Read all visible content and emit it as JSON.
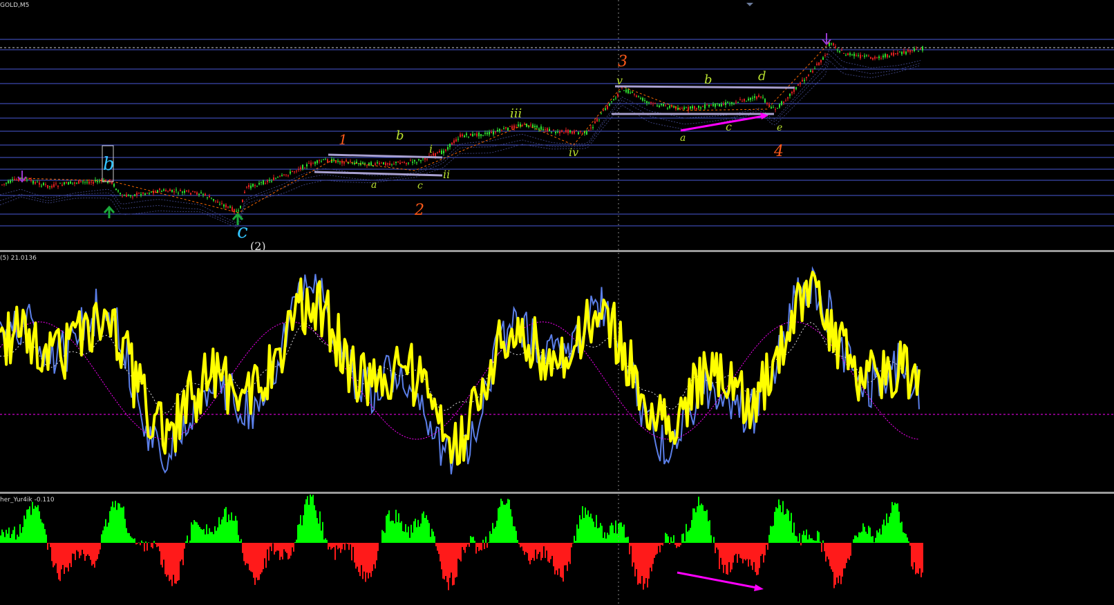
{
  "window": {
    "symbol_label": "GOLD,M5"
  },
  "panes": {
    "price": {
      "label": "GOLD,M5"
    },
    "oscillator": {
      "label": "(5) 21.0136"
    },
    "histogram": {
      "label": "her_Yur4ik -0.110"
    }
  },
  "wave_labels": {
    "wave_b_major": "b",
    "wave_c_major": "c",
    "wave_c_partial": "(2)",
    "wave_1": "1",
    "wave_2": "2",
    "wave_3": "3",
    "wave_4": "4",
    "sub_1": [
      "a",
      "b",
      "c",
      "i",
      "ii"
    ],
    "sub_impulse": [
      "iii",
      "iv",
      "v"
    ],
    "sub_4": [
      "a",
      "b",
      "c",
      "d",
      "e"
    ]
  },
  "colors": {
    "background": "#000000",
    "grid_line": "#4a5ad8",
    "bull_candle": "#2fe02f",
    "bear_candle": "#e02020",
    "main_line": "#ffff00",
    "second_line": "#5b7fe8",
    "signal_line": "#ff00ff",
    "hist_positive": "#00ff00",
    "hist_negative": "#ff1a1a",
    "divergence_arrow": "#ff00ff",
    "wave_orange": "#ff5a1a",
    "wave_cyan": "#33c5ff",
    "wave_lime": "#b8e02f",
    "channel": "#a8a0d0"
  }
}
